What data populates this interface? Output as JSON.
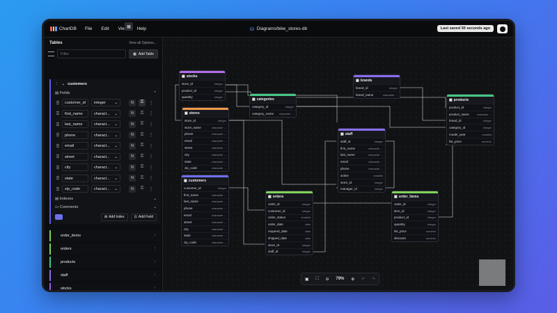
{
  "header": {
    "app_name": "ChartDB",
    "menu": [
      "File",
      "Edit",
      "View",
      "Help"
    ],
    "diagram_title": "Diagrams/bike_stores-db",
    "saved": "Last saved 50 seconds ago"
  },
  "sidebar": {
    "title": "Tables",
    "view_all": "View all Options...",
    "filter_placeholder": "Filter",
    "add_table": "Add Table",
    "selected_table": {
      "name": "customers",
      "fields_label": "Fields",
      "fields": [
        {
          "name": "customer_id",
          "type": "integer",
          "pk": true
        },
        {
          "name": "first_name",
          "type": "charact...",
          "pk": false
        },
        {
          "name": "last_name",
          "type": "charact...",
          "pk": false
        },
        {
          "name": "phone",
          "type": "charact...",
          "pk": false
        },
        {
          "name": "email",
          "type": "charact...",
          "pk": false
        },
        {
          "name": "street",
          "type": "charact...",
          "pk": false
        },
        {
          "name": "city",
          "type": "charact...",
          "pk": false
        },
        {
          "name": "state",
          "type": "charact...",
          "pk": false
        },
        {
          "name": "zip_code",
          "type": "charact...",
          "pk": false
        }
      ],
      "null_label": "N",
      "indexes_label": "Indexes",
      "comments_label": "Comments",
      "add_index": "Add Index",
      "add_field": "Add Field"
    },
    "tables": [
      {
        "name": "order_items",
        "color": "#7fd35c"
      },
      {
        "name": "orders",
        "color": "#7fd35c"
      },
      {
        "name": "products",
        "color": "#47c785"
      },
      {
        "name": "staff",
        "color": "#8a6cf0"
      },
      {
        "name": "stocks",
        "color": "#a259e8"
      },
      {
        "name": "stores",
        "color": "#f29a4a"
      }
    ]
  },
  "canvas": {
    "zoom": "79%",
    "nodes": [
      {
        "id": "stocks",
        "name": "stocks",
        "color": "#b56be8",
        "rows": [
          [
            "store_id",
            "integer"
          ],
          [
            "product_id",
            "integer"
          ],
          [
            "quantity",
            "integer"
          ]
        ]
      },
      {
        "id": "brands",
        "name": "brands",
        "color": "#8a6cf0",
        "rows": [
          [
            "brand_id",
            "integer"
          ],
          [
            "brand_name",
            "character ..."
          ]
        ]
      },
      {
        "id": "products",
        "name": "products",
        "color": "#47c785",
        "rows": [
          [
            "product_id",
            "integer"
          ],
          [
            "product_name",
            "character ..."
          ],
          [
            "brand_id",
            "integer"
          ],
          [
            "category_id",
            "integer"
          ],
          [
            "model_year",
            "smallint"
          ],
          [
            "list_price",
            "numeric"
          ]
        ]
      },
      {
        "id": "categories",
        "name": "categories",
        "color": "#47c785",
        "rows": [
          [
            "category_id",
            "integer"
          ],
          [
            "category_name",
            "character ..."
          ]
        ]
      },
      {
        "id": "stores",
        "name": "stores",
        "color": "#f29a4a",
        "rows": [
          [
            "store_id",
            "integer"
          ],
          [
            "store_name",
            "character ..."
          ],
          [
            "phone",
            "character ..."
          ],
          [
            "email",
            "character ..."
          ],
          [
            "street",
            "character ..."
          ],
          [
            "city",
            "character ..."
          ],
          [
            "state",
            "character ..."
          ],
          [
            "zip_code",
            "character ..."
          ]
        ]
      },
      {
        "id": "staff",
        "name": "staff",
        "color": "#8a6cf0",
        "rows": [
          [
            "staff_id",
            "integer"
          ],
          [
            "first_name",
            "character ..."
          ],
          [
            "last_name",
            "character ..."
          ],
          [
            "email",
            "character ..."
          ],
          [
            "phone",
            "character ..."
          ],
          [
            "active",
            "smallint"
          ],
          [
            "store_id",
            "integer"
          ],
          [
            "manager_id",
            "integer"
          ]
        ]
      },
      {
        "id": "customers",
        "name": "customers",
        "color": "#6d6ff0",
        "rows": [
          [
            "customer_id",
            "integer"
          ],
          [
            "first_name",
            "character ..."
          ],
          [
            "last_name",
            "character ..."
          ],
          [
            "phone",
            "character ..."
          ],
          [
            "email",
            "character ..."
          ],
          [
            "street",
            "character ..."
          ],
          [
            "city",
            "character ..."
          ],
          [
            "state",
            "character ..."
          ],
          [
            "zip_code",
            "character ..."
          ]
        ]
      },
      {
        "id": "orders",
        "name": "orders",
        "color": "#7fd35c",
        "rows": [
          [
            "order_id",
            "integer"
          ],
          [
            "customer_id",
            "integer"
          ],
          [
            "order_status",
            "smallint"
          ],
          [
            "order_date",
            "date"
          ],
          [
            "required_date",
            "date"
          ],
          [
            "shipped_date",
            "date"
          ],
          [
            "store_id",
            "integer"
          ],
          [
            "staff_id",
            "integer"
          ]
        ]
      },
      {
        "id": "order_items",
        "name": "order_items",
        "color": "#7fd35c",
        "rows": [
          [
            "order_id",
            "integer"
          ],
          [
            "item_id",
            "integer"
          ],
          [
            "product_id",
            "integer"
          ],
          [
            "quantity",
            "integer"
          ],
          [
            "list_price",
            "numeric"
          ],
          [
            "discount",
            "numeric"
          ]
        ]
      }
    ]
  }
}
